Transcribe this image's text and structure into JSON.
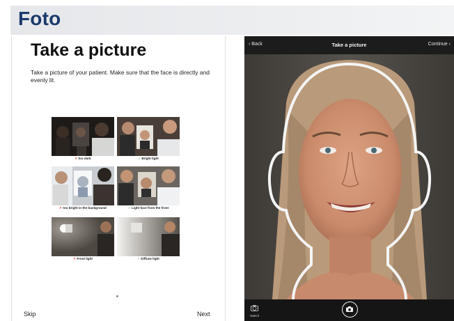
{
  "header": {
    "title": "Foto"
  },
  "left": {
    "title": "Take a picture",
    "description": "Take a picture of your patient. Make sure that the face is directly and evenly lit.",
    "examples": [
      {
        "mark": "✗",
        "good": false,
        "caption": "too dark"
      },
      {
        "mark": "✓",
        "good": true,
        "caption": "Bright light"
      },
      {
        "mark": "✗",
        "good": false,
        "caption": "too bright in the background"
      },
      {
        "mark": "✓",
        "good": true,
        "caption": "Light face from the front"
      },
      {
        "mark": "✗",
        "good": false,
        "caption": "Front light"
      },
      {
        "mark": "✓",
        "good": true,
        "caption": "Diffuse light"
      }
    ],
    "skip_label": "Skip",
    "next_label": "Next"
  },
  "camera": {
    "back_label": "Back",
    "title": "Take a picture",
    "continue_label": "Continue",
    "switch_label": "Switch",
    "icons": {
      "back": "chevron-left-icon",
      "continue": "chevron-right-icon",
      "switch": "switch-camera-icon",
      "shutter": "camera-icon"
    }
  },
  "colors": {
    "brand_blue": "#1b3a6b",
    "bad": "#d9261c",
    "good": "#2e9b3a"
  }
}
